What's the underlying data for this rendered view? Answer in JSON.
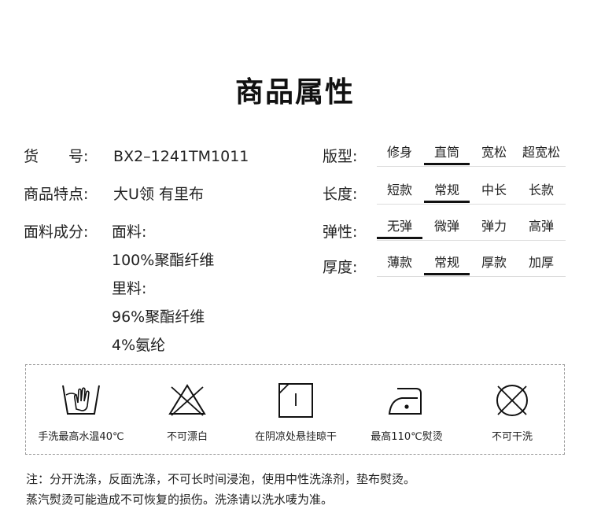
{
  "title": "商品属性",
  "info": {
    "item_no": {
      "label": "货　　号:",
      "value": "BX2–1241TM1011"
    },
    "feature": {
      "label": "商品特点:",
      "value": "大U领 有里布"
    },
    "material": {
      "label": "面料成分:",
      "lines": [
        "面料:",
        "100%聚酯纤维",
        "里料:",
        "96%聚酯纤维",
        "4%氨纶"
      ]
    }
  },
  "attributes": [
    {
      "label": "版型:",
      "options": [
        "修身",
        "直筒",
        "宽松",
        "超宽松"
      ],
      "selected": 1
    },
    {
      "label": "长度:",
      "options": [
        "短款",
        "常规",
        "中长",
        "长款"
      ],
      "selected": 1
    },
    {
      "label": "弹性:",
      "options": [
        "无弹",
        "微弹",
        "弹力",
        "高弹"
      ],
      "selected": 0
    },
    {
      "label": "厚度:",
      "options": [
        "薄款",
        "常规",
        "厚款",
        "加厚"
      ],
      "selected": 1
    }
  ],
  "care": [
    {
      "icon": "hand-wash-icon",
      "label": "手洗最高水温40℃"
    },
    {
      "icon": "no-bleach-icon",
      "label": "不可漂白"
    },
    {
      "icon": "dry-in-shade-icon",
      "label": "在阴凉处悬挂晾干"
    },
    {
      "icon": "iron-icon",
      "label": "最高110℃熨烫"
    },
    {
      "icon": "no-dry-clean-icon",
      "label": "不可干洗"
    }
  ],
  "notes": [
    "注：分开洗涤，反面洗涤，不可长时间浸泡，使用中性洗涤剂，垫布熨烫。",
    "蒸汽熨烫可能造成不可恢复的损伤。洗涤请以洗水唛为准。"
  ]
}
